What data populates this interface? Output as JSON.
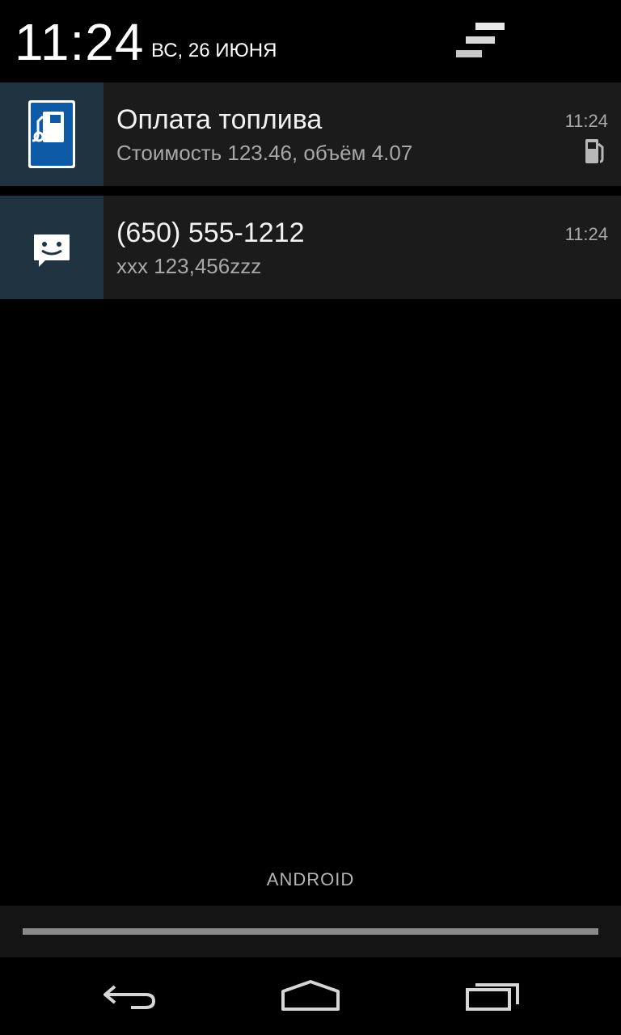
{
  "header": {
    "time": "11:24",
    "date": "ВС, 26 ИЮНЯ",
    "clear_icon": "clear-all-icon"
  },
  "notifications": [
    {
      "app_icon": "fuel-station-sign-icon",
      "title": "Оплата топлива",
      "text": "Стоимость 123.46, объём 4.07",
      "time": "11:24",
      "small_icon": "fuel-pump-icon"
    },
    {
      "app_icon": "message-smiley-icon",
      "title": "(650) 555-1212",
      "text": "xxx 123,456zzz",
      "time": "11:24"
    }
  ],
  "carrier_label": "ANDROID",
  "navbar": {
    "back_icon": "back-icon",
    "home_icon": "home-icon",
    "recents_icon": "recents-icon"
  },
  "colors": {
    "notification_bg": "#1b1b1b",
    "icon_bg": "#1f3341",
    "fuel_sign_blue": "#0f5aa7",
    "secondary_text": "#a8a8a8"
  }
}
